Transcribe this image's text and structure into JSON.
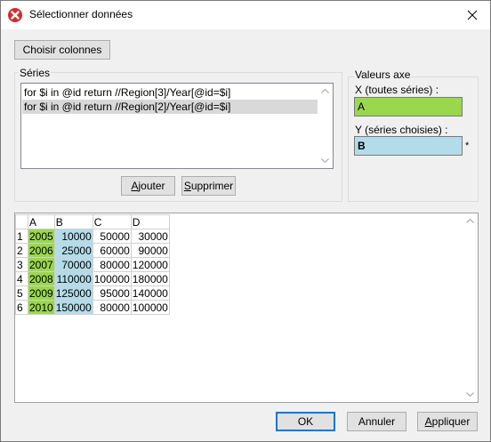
{
  "window": {
    "title": "Sélectionner données",
    "icon": "altova-x-icon"
  },
  "toolbar": {
    "choose_columns_label": "Choisir colonnes"
  },
  "series_group": {
    "label": "Séries",
    "items": [
      {
        "text": "for $i in @id return //Region[3]/Year[@id=$i]",
        "selected": false
      },
      {
        "text": "for $i in @id return //Region[2]/Year[@id=$i]",
        "selected": true
      }
    ],
    "add_label_mnemonic": "A",
    "add_label_rest": "jouter",
    "remove_label_mnemonic": "S",
    "remove_label_rest": "upprimer"
  },
  "axis_values": {
    "label": "Valeurs axe",
    "x_label": "X (toutes séries) :",
    "x_value": "A",
    "x_color": "#99d84d",
    "y_label": "Y (séries choisies) :",
    "y_value": "B",
    "y_color": "#b3dcea",
    "y_marker": "*"
  },
  "grid": {
    "columns": [
      "A",
      "B",
      "C",
      "D"
    ],
    "rows": [
      {
        "index": "1",
        "cells": [
          "2005",
          "10000",
          "50000",
          "30000"
        ]
      },
      {
        "index": "2",
        "cells": [
          "2006",
          "25000",
          "60000",
          "90000"
        ]
      },
      {
        "index": "3",
        "cells": [
          "2007",
          "70000",
          "80000",
          "120000"
        ]
      },
      {
        "index": "4",
        "cells": [
          "2008",
          "110000",
          "100000",
          "180000"
        ]
      },
      {
        "index": "5",
        "cells": [
          "2009",
          "125000",
          "95000",
          "140000"
        ]
      },
      {
        "index": "6",
        "cells": [
          "2010",
          "150000",
          "80000",
          "100000"
        ]
      }
    ]
  },
  "footer": {
    "ok_label": "OK",
    "cancel_label": "Annuler",
    "apply_label_mnemonic": "A",
    "apply_label_rest": "ppliquer"
  }
}
